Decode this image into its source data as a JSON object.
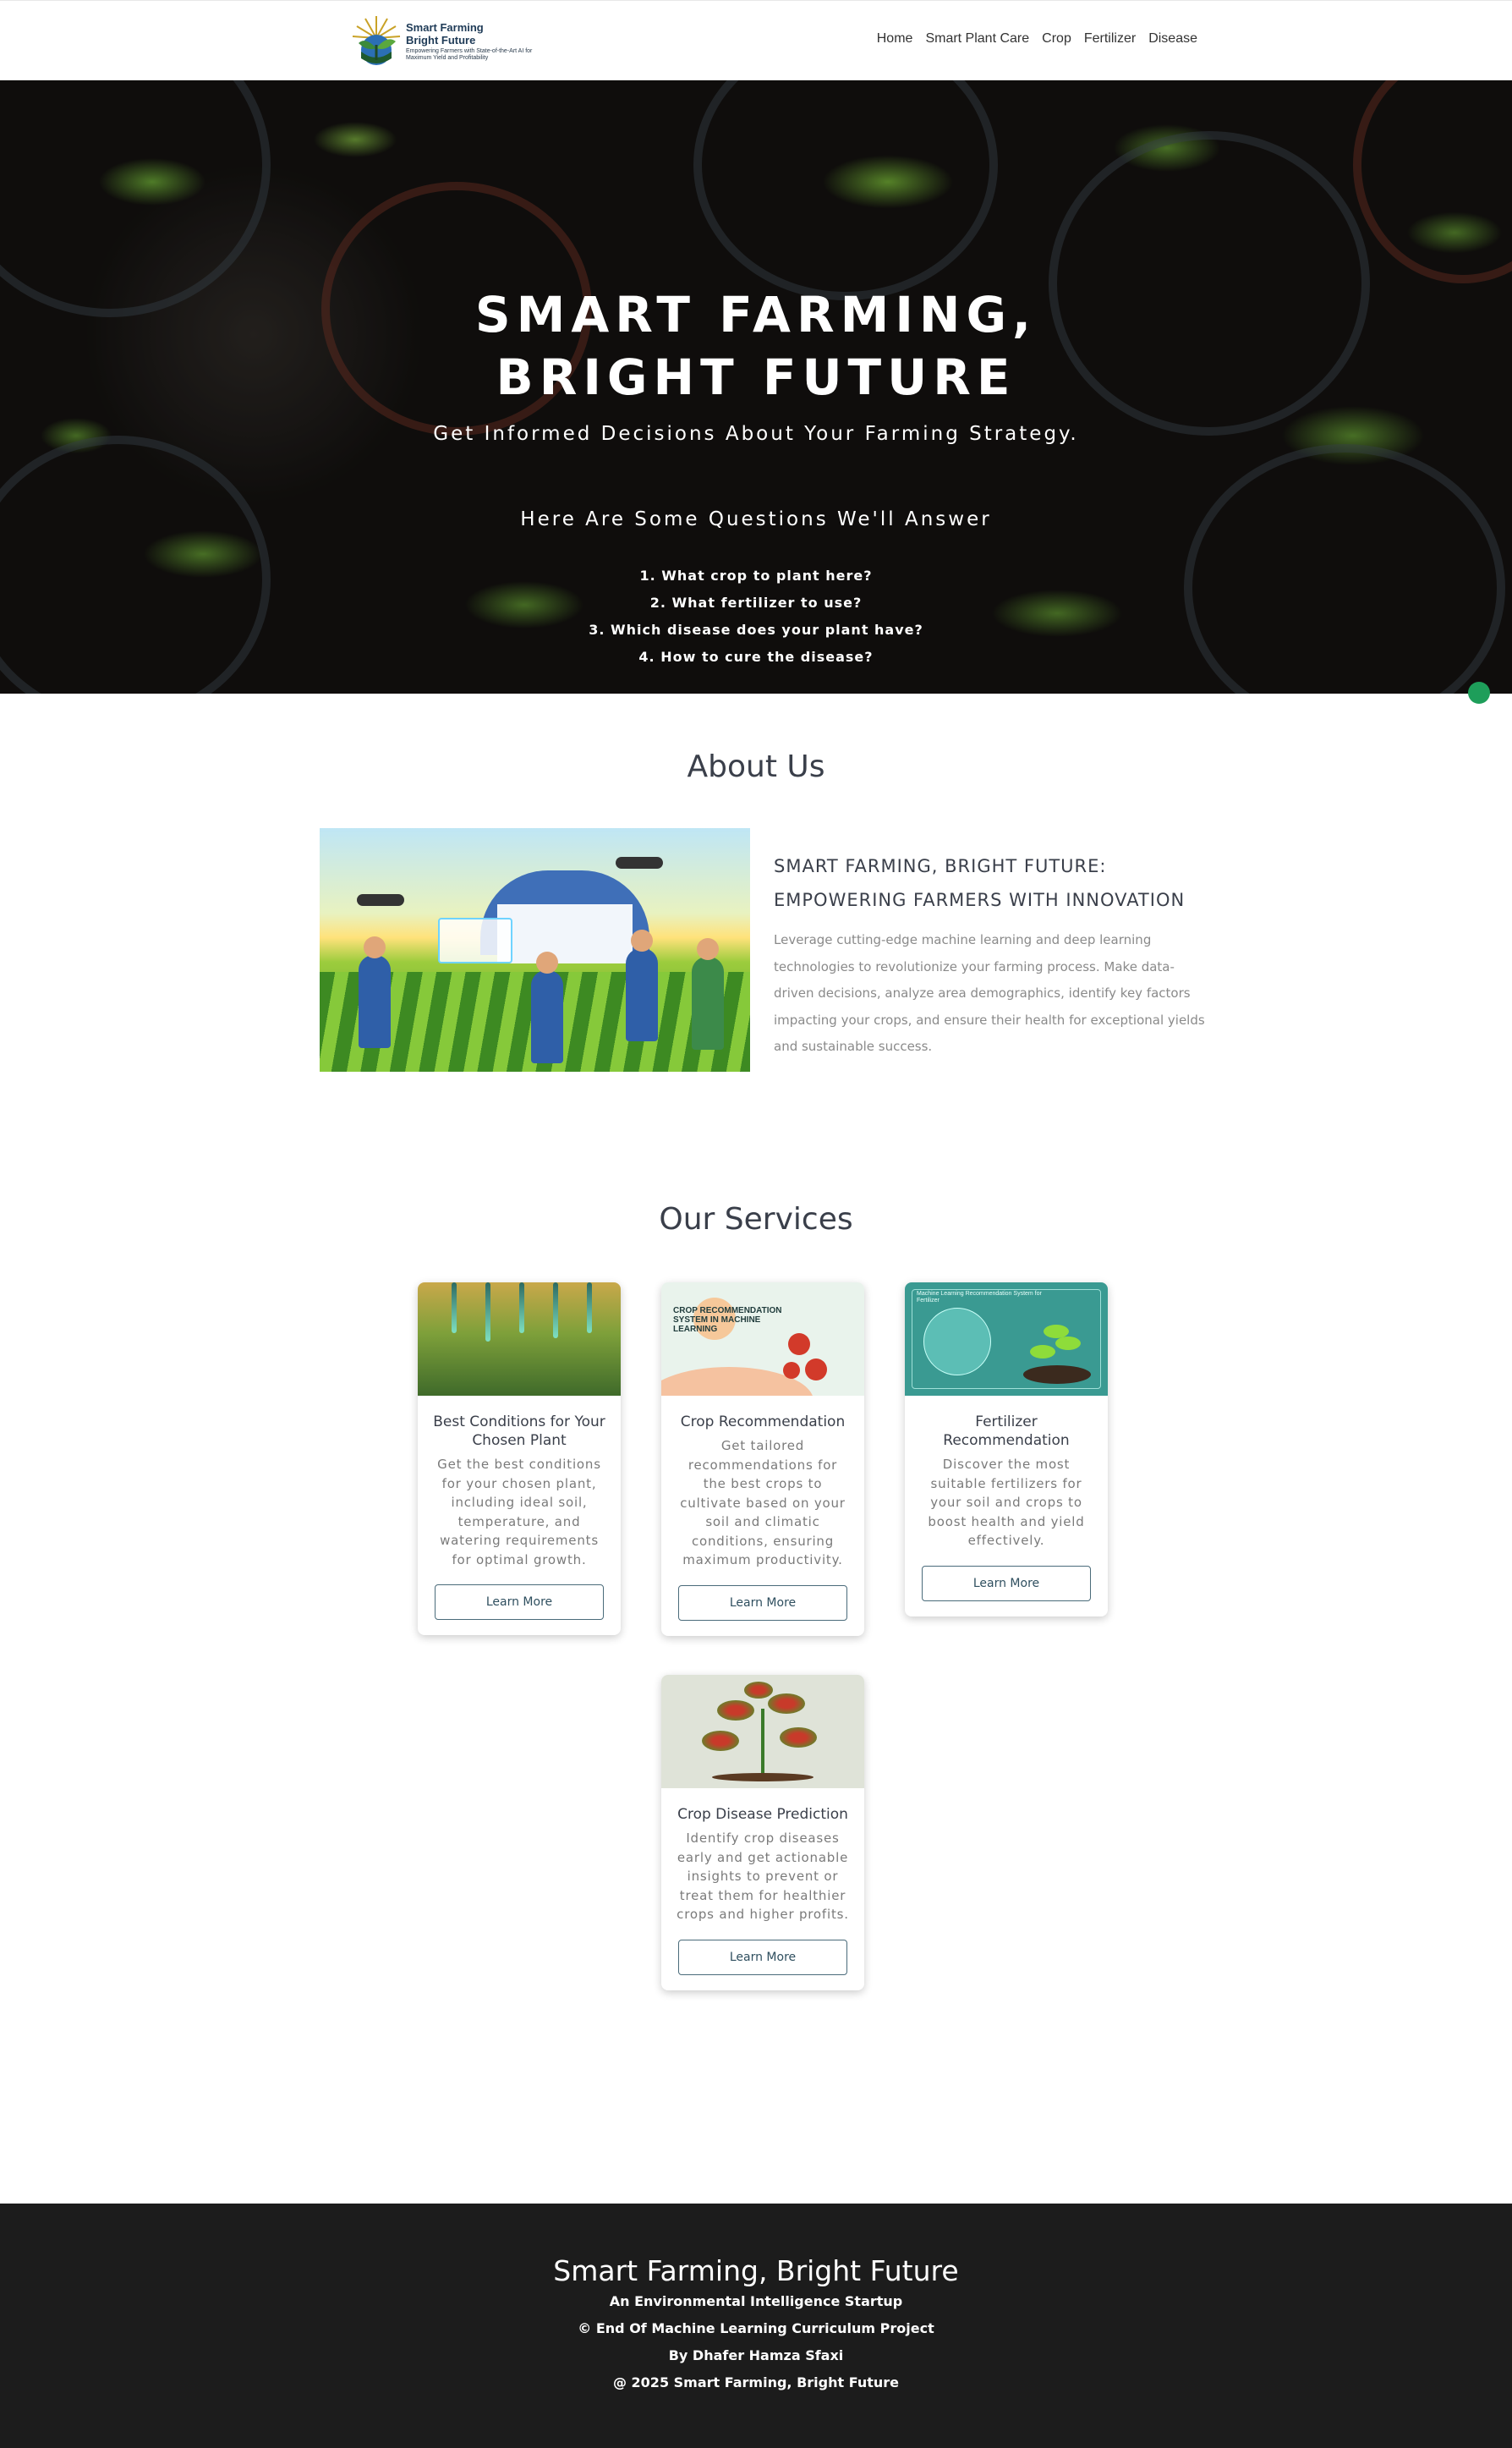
{
  "nav": {
    "logo_line1": "Smart Farming",
    "logo_line2": "Bright Future",
    "logo_tagline": "Empowering Farmers with State-of-the-Art AI for Maximum Yield and Profitability",
    "links": [
      "Home",
      "Smart Plant Care",
      "Crop",
      "Fertilizer",
      "Disease"
    ]
  },
  "hero": {
    "title": "SMART FARMING, BRIGHT FUTURE",
    "subtitle": "Get Informed Decisions About Your Farming Strategy.",
    "questions_heading": "Here Are Some Questions We'll Answer",
    "questions": [
      "1. What crop to plant here?",
      "2. What fertilizer to use?",
      "3. Which disease does your plant have?",
      "4. How to cure the disease?"
    ]
  },
  "about": {
    "title": "About Us",
    "heading": "SMART FARMING, BRIGHT FUTURE: EMPOWERING FARMERS WITH INNOVATION",
    "body": "Leverage cutting-edge machine learning and deep learning technologies to revolutionize your farming process. Make data-driven decisions, analyze area demographics, identify key factors impacting your crops, and ensure their health for exceptional yields and sustainable success."
  },
  "services": {
    "title": "Our Services",
    "cards": [
      {
        "title": "Best Conditions for Your Chosen Plant",
        "desc": "Get the best conditions for your chosen plant, including ideal soil, temperature, and watering requirements for optimal growth.",
        "button": "Learn More"
      },
      {
        "title": "Crop Recommendation",
        "desc": "Get tailored recommendations for the best crops to cultivate based on your soil and climatic conditions, ensuring maximum productivity.",
        "button": "Learn More",
        "image_label": "CROP RECOMMENDATION SYSTEM IN MACHINE LEARNING"
      },
      {
        "title": "Fertilizer Recommendation",
        "desc": "Discover the most suitable fertilizers for your soil and crops to boost health and yield effectively.",
        "button": "Learn More",
        "image_label": "Machine Learning Recommendation System for Fertilizer"
      },
      {
        "title": "Crop Disease Prediction",
        "desc": "Identify crop diseases early and get actionable insights to prevent or treat them for healthier crops and higher profits.",
        "button": "Learn More"
      }
    ]
  },
  "footer": {
    "title": "Smart Farming, Bright Future",
    "line1": "An Environmental Intelligence Startup",
    "line2": "© End Of Machine Learning Curriculum Project",
    "line3": "By Dhafer Hamza Sfaxi",
    "line4": "@ 2025 Smart Farming, Bright Future"
  },
  "colors": {
    "footer_bg": "#1c1c1c",
    "button_border": "#4a6b7a",
    "accent_green": "#1e9e5a"
  }
}
